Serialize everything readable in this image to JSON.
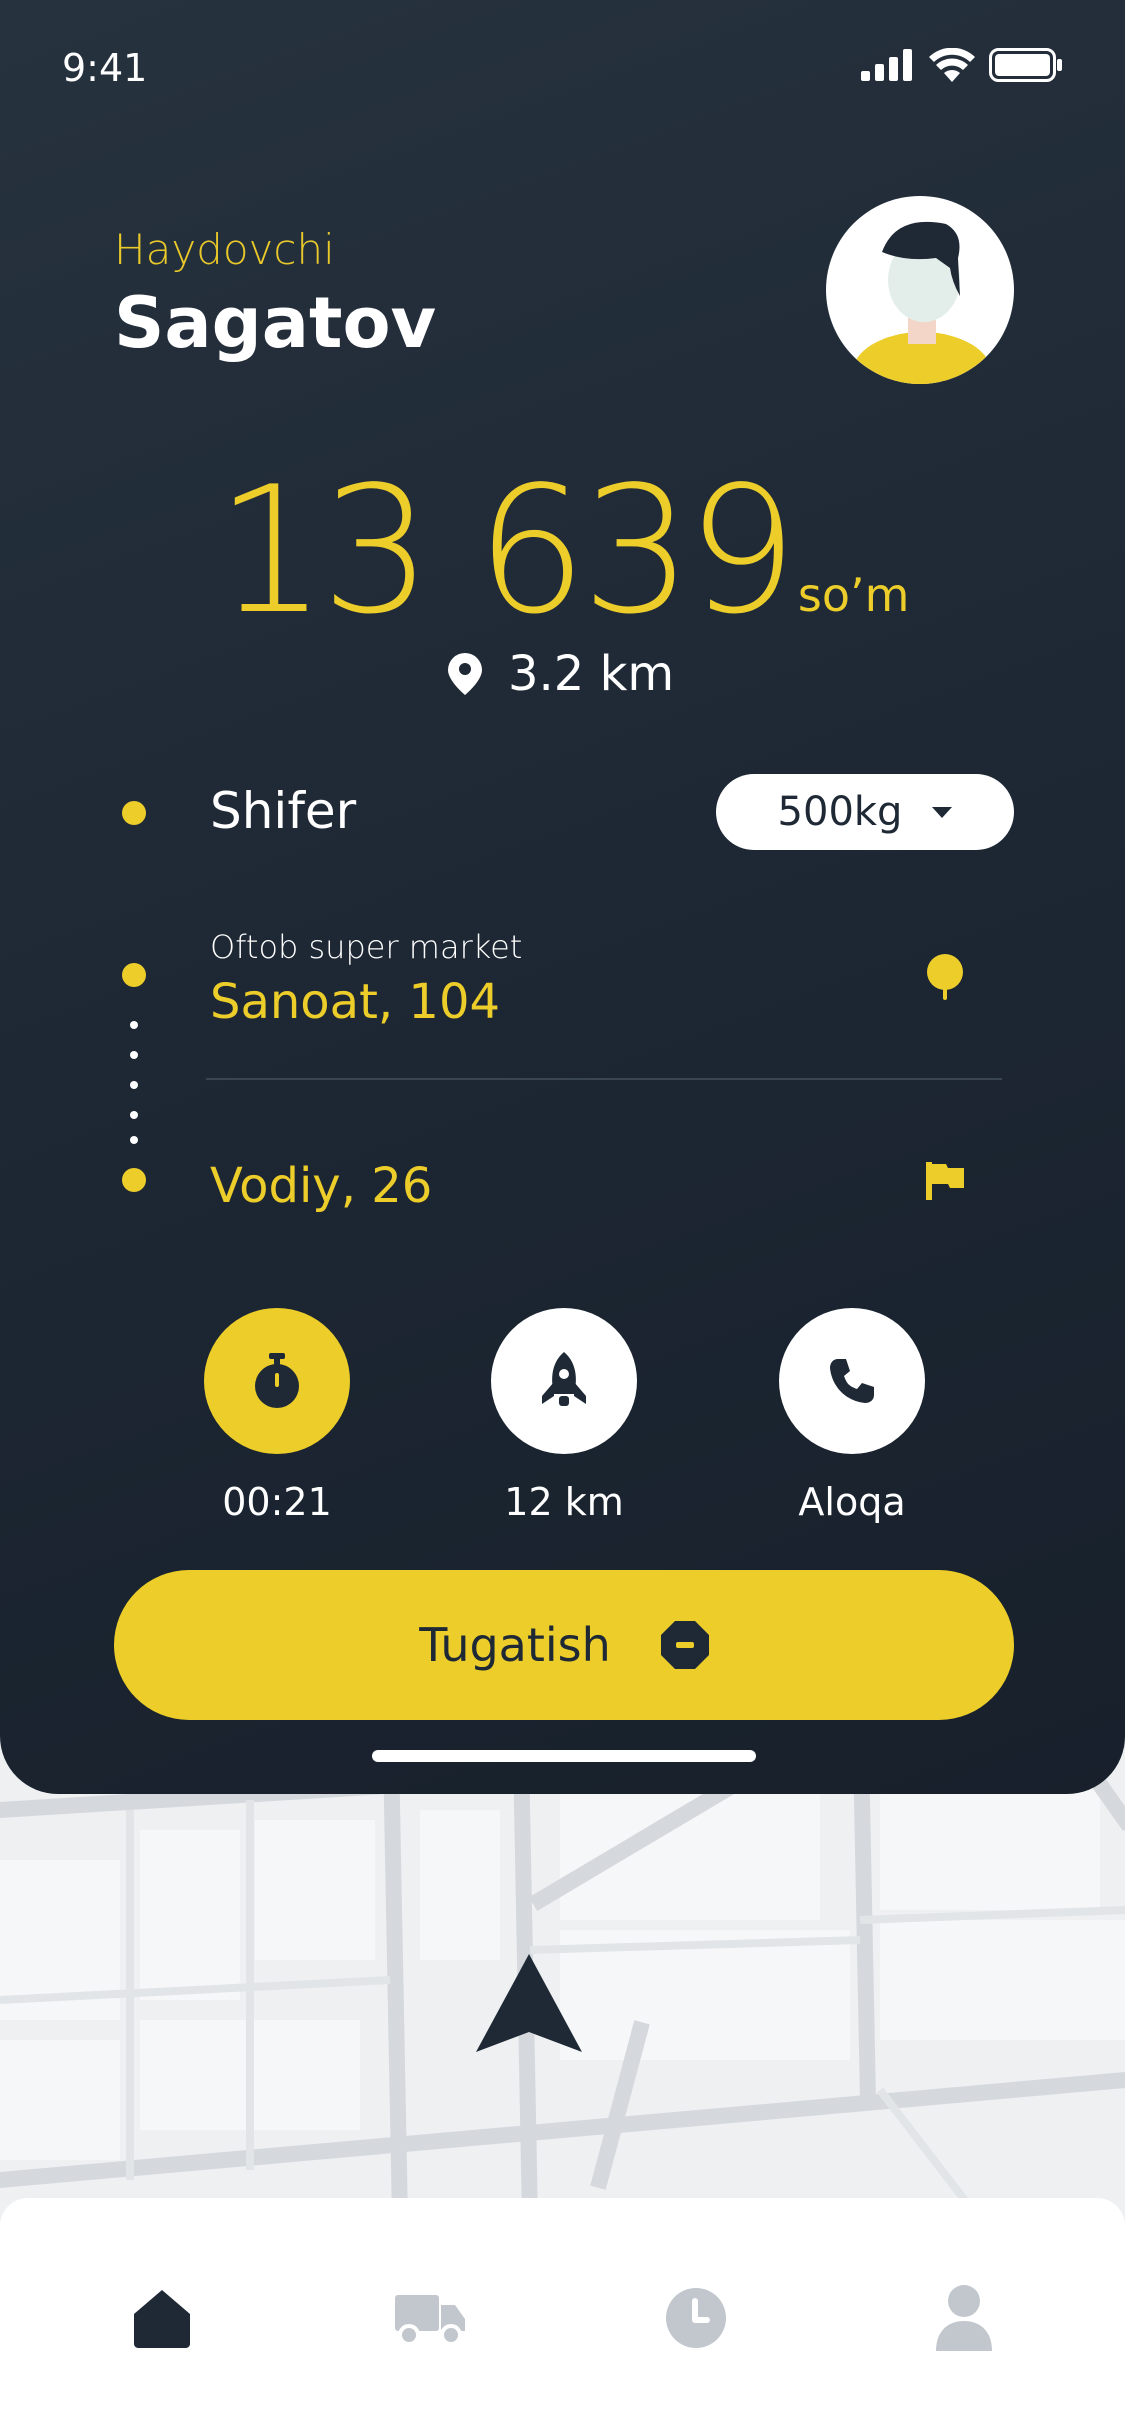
{
  "status_bar": {
    "time": "9:41"
  },
  "driver": {
    "role": "Haydovchi",
    "name": "Sagatov"
  },
  "fare": {
    "amount": "13 639",
    "currency": "so’m"
  },
  "distance": "3.2 km",
  "cargo": {
    "name": "Shifer",
    "weight": "500kg"
  },
  "route": {
    "from_label": "Oftob super market",
    "from_address": "Sanoat, 104",
    "to_address": "Vodiy, 26"
  },
  "actions": [
    {
      "label": "00:21",
      "icon": "stopwatch-icon"
    },
    {
      "label": "12 km",
      "icon": "rocket-icon"
    },
    {
      "label": "Aloqa",
      "icon": "phone-icon"
    }
  ],
  "finish_button": {
    "label": "Tugatish"
  },
  "tabs": [
    {
      "icon": "home-icon",
      "active": true
    },
    {
      "icon": "truck-icon",
      "active": false
    },
    {
      "icon": "clock-icon",
      "active": false
    },
    {
      "icon": "user-icon",
      "active": false
    }
  ],
  "colors": {
    "accent": "#eccd2a",
    "dark": "#1e2935",
    "inactive": "#c2c7cd"
  }
}
